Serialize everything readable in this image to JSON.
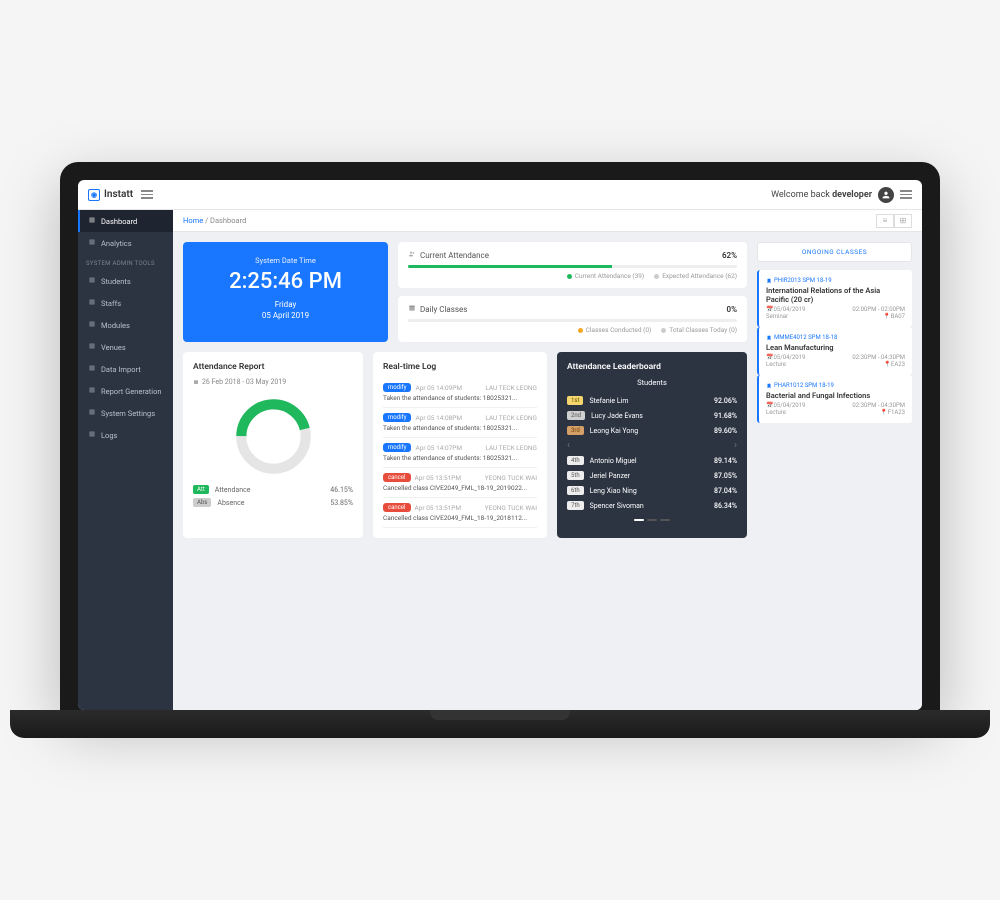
{
  "brand": "Instatt",
  "topbar": {
    "welcome_prefix": "Welcome back ",
    "username": "developer"
  },
  "breadcrumb": {
    "home": "Home",
    "sep": "/",
    "current": "Dashboard"
  },
  "sidebar": {
    "items_top": [
      {
        "label": "Dashboard",
        "icon": "dashboard-icon"
      },
      {
        "label": "Analytics",
        "icon": "analytics-icon"
      }
    ],
    "section": "SYSTEM ADMIN TOOLS",
    "items_admin": [
      {
        "label": "Students",
        "icon": "students-icon"
      },
      {
        "label": "Staffs",
        "icon": "staffs-icon"
      },
      {
        "label": "Modules",
        "icon": "modules-icon"
      },
      {
        "label": "Venues",
        "icon": "venues-icon"
      },
      {
        "label": "Data Import",
        "icon": "import-icon"
      },
      {
        "label": "Report Generation",
        "icon": "report-icon"
      },
      {
        "label": "System Settings",
        "icon": "settings-icon"
      },
      {
        "label": "Logs",
        "icon": "logs-icon"
      }
    ]
  },
  "clock": {
    "label": "System Date Time",
    "time": "2:25:46 PM",
    "day": "Friday",
    "date": "05 April 2019"
  },
  "stats": {
    "attendance": {
      "title": "Current Attendance",
      "pct": "62%",
      "fill": 62,
      "sub1": "Current Attendance (39)",
      "sub2": "Expected Attendance (62)"
    },
    "classes": {
      "title": "Daily Classes",
      "pct": "0%",
      "fill": 0,
      "sub1": "Classes Conducted (0)",
      "sub2": "Total Classes Today (0)"
    }
  },
  "attendance_report": {
    "title": "Attendance Report",
    "range": "26 Feb 2018 - 03 May 2019",
    "att_label": "Attendance",
    "att_pct": "46.15%",
    "abs_label": "Absence",
    "abs_pct": "53.85%",
    "att_tag": "Att",
    "abs_tag": "Abs"
  },
  "realtime": {
    "title": "Real-time Log",
    "items": [
      {
        "tag": "modify",
        "time": "Apr 05 14:09PM",
        "user": "LAU TECK LEONG",
        "body": "Taken the attendance of students: 18025321..."
      },
      {
        "tag": "modify",
        "time": "Apr 05 14:08PM",
        "user": "LAU TECK LEONG",
        "body": "Taken the attendance of students: 18025321..."
      },
      {
        "tag": "modify",
        "time": "Apr 05 14:07PM",
        "user": "LAU TECK LEONG",
        "body": "Taken the attendance of students: 18025321..."
      },
      {
        "tag": "cancel",
        "time": "Apr 05 13:51PM",
        "user": "YEONG TUCK WAI",
        "body": "Cancelled class CIVE2049_FML_18-19_2019022..."
      },
      {
        "tag": "cancel",
        "time": "Apr 05 13:51PM",
        "user": "YEONG TUCK WAI",
        "body": "Cancelled class CIVE2049_FML_18-19_2018112..."
      }
    ]
  },
  "leaderboard": {
    "title": "Attendance Leaderboard",
    "subtitle": "Students",
    "rows": [
      {
        "rank": "1st",
        "cls": "rank-1",
        "name": "Stefanie Lim",
        "pct": "92.06%"
      },
      {
        "rank": "2nd",
        "cls": "rank-2",
        "name": "Lucy Jade Evans",
        "pct": "91.68%"
      },
      {
        "rank": "3rd",
        "cls": "rank-3",
        "name": "Leong Kai Yong",
        "pct": "89.60%"
      },
      {
        "rank": "4th",
        "cls": "rank-other",
        "name": "Antonio Miguel",
        "pct": "89.14%"
      },
      {
        "rank": "5th",
        "cls": "rank-other",
        "name": "Jeriel Panzer",
        "pct": "87.05%"
      },
      {
        "rank": "6th",
        "cls": "rank-other",
        "name": "Leng Xiao Ning",
        "pct": "87.04%"
      },
      {
        "rank": "7th",
        "cls": "rank-other",
        "name": "Spencer Sivoman",
        "pct": "86.34%"
      }
    ]
  },
  "ongoing": {
    "heading": "ONGOING CLASSES",
    "items": [
      {
        "code": "PHIR2013 SPM 18-19",
        "title": "International Relations of the Asia Pacific (20 cr)",
        "date": "05/04/2019",
        "time": "02:00PM - 02:00PM",
        "type": "Seminar",
        "room": "BA07"
      },
      {
        "code": "MMME4012 SPM 18-18",
        "title": "Lean Manufacturing",
        "date": "05/04/2019",
        "time": "02:30PM - 04:30PM",
        "type": "Lecture",
        "room": "EA23"
      },
      {
        "code": "PHAR1012 SPM 18-19",
        "title": "Bacterial and Fungal Infections",
        "date": "05/04/2019",
        "time": "02:30PM - 04:30PM",
        "type": "Lecture",
        "room": "F1A23"
      }
    ]
  },
  "chart_data": {
    "type": "pie",
    "title": "Attendance Report",
    "series": [
      {
        "name": "Attendance",
        "value": 46.15,
        "color": "#1fb85c"
      },
      {
        "name": "Absence",
        "value": 53.85,
        "color": "#e5e5e5"
      }
    ]
  }
}
